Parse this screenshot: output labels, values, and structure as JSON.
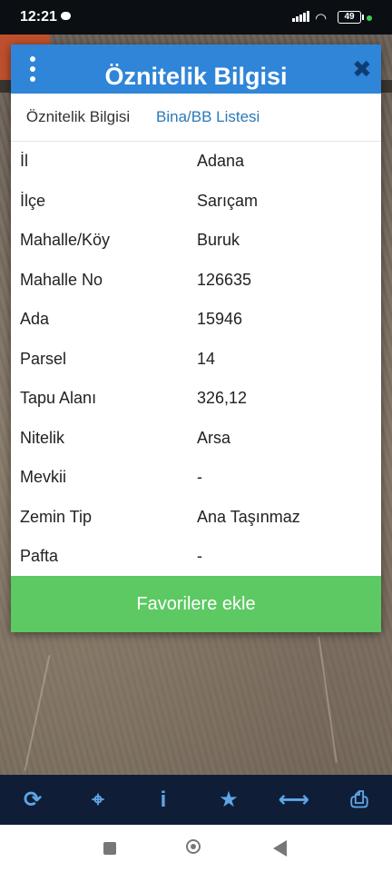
{
  "status_bar": {
    "time": "12:21",
    "battery": "49"
  },
  "dialog": {
    "title": "Öznitelik Bilgisi",
    "tabs": [
      {
        "label": "Öznitelik Bilgisi"
      },
      {
        "label": "Bina/BB Listesi"
      }
    ],
    "rows": [
      {
        "key": "İl",
        "value": "Adana"
      },
      {
        "key": "İlçe",
        "value": "Sarıçam"
      },
      {
        "key": "Mahalle/Köy",
        "value": "Buruk"
      },
      {
        "key": "Mahalle No",
        "value": "126635"
      },
      {
        "key": "Ada",
        "value": "15946"
      },
      {
        "key": "Parsel",
        "value": "14"
      },
      {
        "key": "Tapu Alanı",
        "value": "326,12"
      },
      {
        "key": "Nitelik",
        "value": "Arsa"
      },
      {
        "key": "Mevkii",
        "value": "-"
      },
      {
        "key": "Zemin Tip",
        "value": "Ana Taşınmaz"
      },
      {
        "key": "Pafta",
        "value": "-"
      }
    ],
    "favorite_button": "Favorilere ekle"
  },
  "toolbar": {
    "icons": [
      "refresh-icon",
      "locate-icon",
      "info-icon",
      "star-icon",
      "measure-icon",
      "print-icon"
    ]
  },
  "colors": {
    "header": "#2f85d8",
    "button": "#5cc962",
    "toolbar": "#0f1e36",
    "toolbar_icon": "#5fa6e8"
  }
}
